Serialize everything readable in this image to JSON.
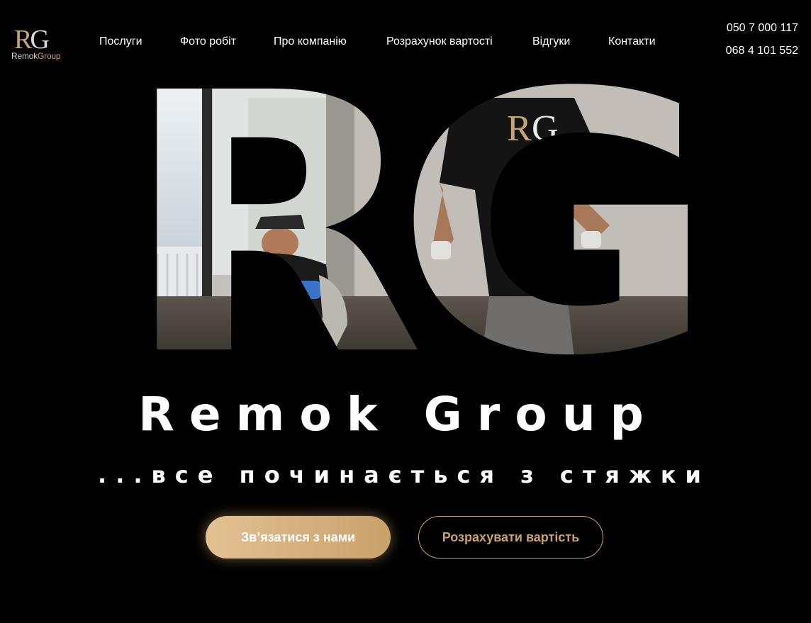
{
  "logo": {
    "letter_r": "R",
    "letter_g": "G",
    "name_main": "Remok",
    "name_group": "Group"
  },
  "nav": {
    "items": [
      {
        "label": "Послуги"
      },
      {
        "label": "Фото робіт"
      },
      {
        "label": "Про компанію"
      },
      {
        "label": "Розрахунок вартості"
      },
      {
        "label": "Відгуки"
      },
      {
        "label": "Контакти"
      }
    ]
  },
  "phones": [
    "050 7 000 117",
    "068 4 101 552"
  ],
  "hero": {
    "letters": "RG",
    "title": "Remok Group",
    "tagline": "...все починається з стяжки",
    "cta_primary": "Зв’язатися з нами",
    "cta_secondary": "Розрахувати вартість"
  },
  "colors": {
    "accent": "#c9a16b",
    "background": "#000000",
    "text": "#ffffff"
  }
}
